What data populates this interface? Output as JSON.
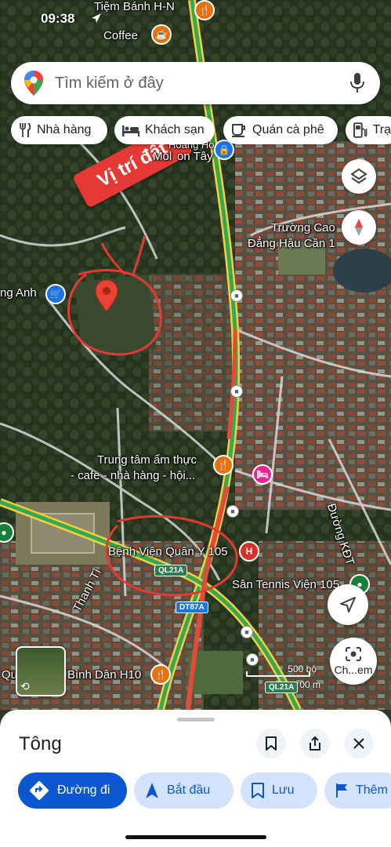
{
  "status": {
    "time": "09:38"
  },
  "search": {
    "placeholder": "Tìm kiếm ở đây"
  },
  "chips": [
    {
      "label": "Nhà hàng",
      "icon": "fork-knife-icon"
    },
    {
      "label": "Khách sạn",
      "icon": "bed-icon"
    },
    {
      "label": "Quán cà phê",
      "icon": "coffee-cup-icon"
    },
    {
      "label": "Trạ",
      "icon": "gas-station-icon"
    }
  ],
  "annotation": {
    "text": "Vị trí đất",
    "color": "#e53935"
  },
  "map_labels": {
    "bakery": "Tiệm Bánh H-N",
    "coffee": "Coffee",
    "college_line1": "Trường Cao",
    "college_line2": "Đẳng Hậu Cần 1",
    "mol": "Mol",
    "hoang": "Hoàng Ho",
    "son_tay": "on Tây",
    "ng_anh": "ng Anh",
    "food_line1": "Trung tâm ẩm thực",
    "food_line2": "- cafe - nhà hàng - hội...",
    "hospital": "Bệnh Viện Quân Y 105",
    "tennis": "Sân Tennis Viện 105",
    "street_thanh": "Thanh Tì",
    "street_kdt": "Đường KĐT",
    "binh_dan": "Bình Dân H10",
    "qu": "Qu",
    "scale_top": "500 bộ",
    "scale_bottom": "00 m"
  },
  "shields": {
    "ql21a": "QL21A",
    "dt87a": "DT87A",
    "ql21a_2": "QL21A"
  },
  "fabs": {
    "layers": "layers-icon",
    "compass": "compass-icon",
    "navigate": "navigation-arrow-icon",
    "lens_label": "Ch...em"
  },
  "sheet": {
    "title": "Tông",
    "actions": [
      {
        "label": "Đường đi",
        "icon": "directions-icon"
      },
      {
        "label": "Bắt đầu",
        "icon": "navigation-arrow-icon"
      },
      {
        "label": "Lưu",
        "icon": "bookmark-icon"
      },
      {
        "label": "Thêm",
        "icon": "flag-icon"
      }
    ]
  },
  "colors": {
    "accent": "#0b57d0",
    "pin": "#ea4335",
    "road": "#f4d03f",
    "traffic": "#34a853"
  }
}
